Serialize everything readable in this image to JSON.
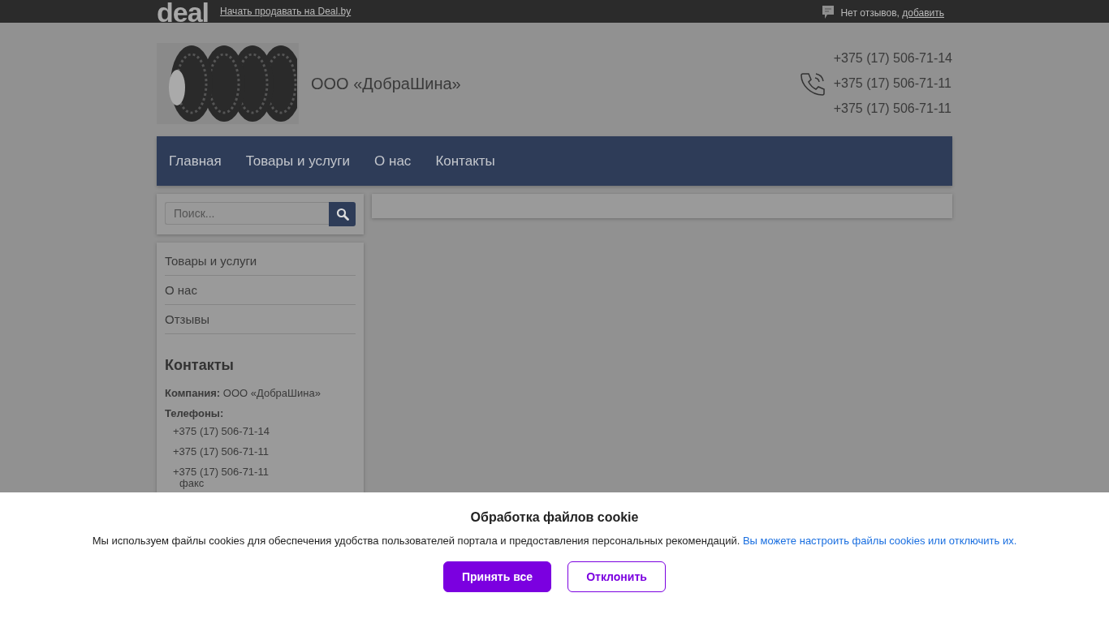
{
  "top_bar": {
    "logo": "deal",
    "sell_link": "Начать продавать на Deal.by",
    "reviews_text": "Нет отзывов, ",
    "reviews_link": "добавить"
  },
  "header": {
    "company_name": "ООО «ДобраШина»",
    "phones": [
      "+375 (17) 506-71-14",
      "+375 (17) 506-71-11",
      "+375 (17) 506-71-11"
    ]
  },
  "nav": {
    "items": [
      "Главная",
      "Товары и услуги",
      "О нас",
      "Контакты"
    ]
  },
  "sidebar": {
    "search": {
      "placeholder": "Поиск..."
    },
    "menu": [
      "Товары и услуги",
      "О нас",
      "Отзывы"
    ],
    "contacts": {
      "title": "Контакты",
      "company_label": "Компания:",
      "company_value": "ООО «ДобраШина»",
      "phones_label": "Телефоны:",
      "phones": [
        {
          "number": "+375 (17) 506-71-14"
        },
        {
          "number": "+375 (17) 506-71-11"
        },
        {
          "number": "+375 (17) 506-71-11",
          "note": "факс"
        }
      ]
    }
  },
  "cookie_banner": {
    "title": "Обработка файлов cookie",
    "text": "Мы используем файлы cookies для обеспечения удобства пользователей портала и предоставления персональных рекомендаций.",
    "link": "Вы можете настроить файлы cookies или отключить их.",
    "buttons": [
      {
        "label": "Принять все",
        "kind": "primary"
      },
      {
        "label": "Отклонить",
        "kind": "secondary"
      }
    ]
  }
}
